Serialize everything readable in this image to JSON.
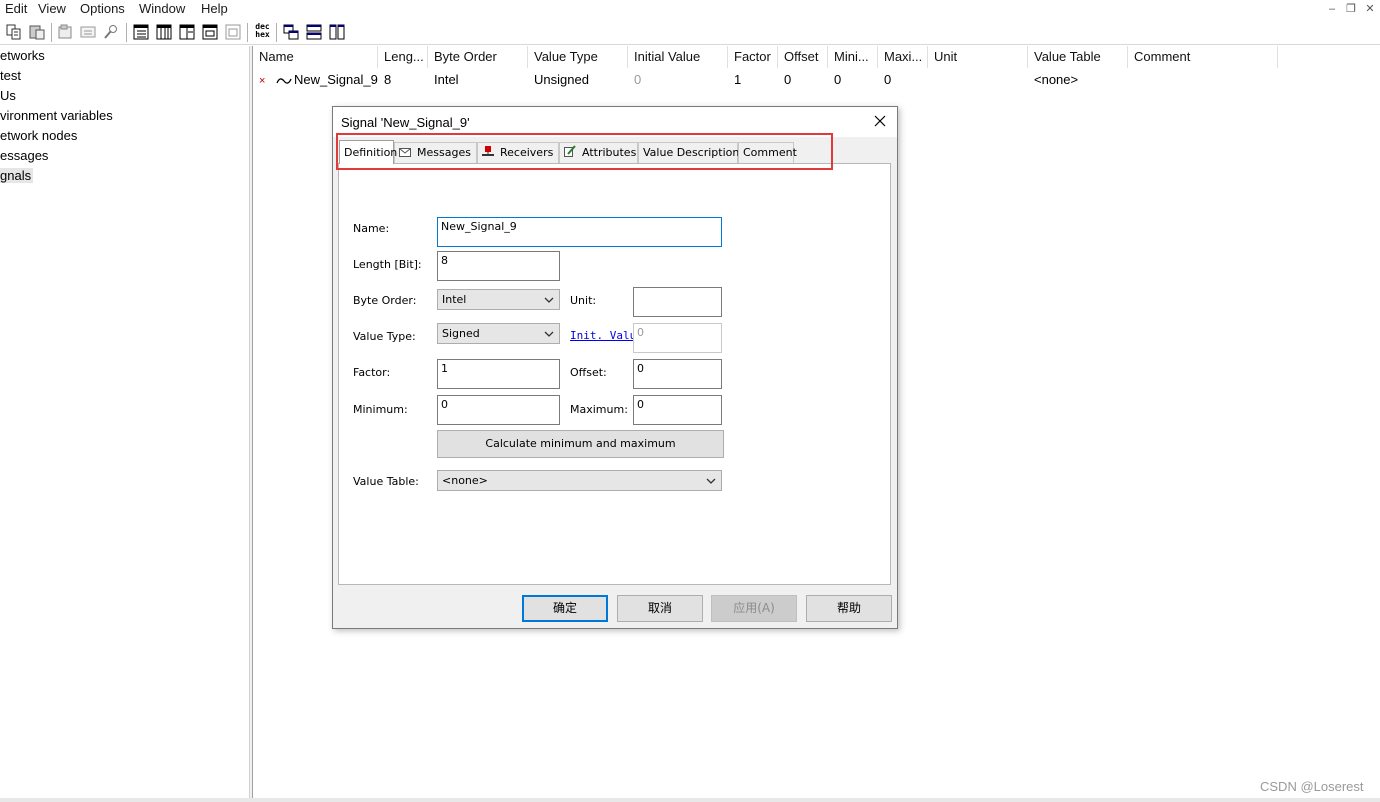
{
  "menubar": {
    "items": [
      "Edit",
      "View",
      "Options",
      "Window",
      "Help"
    ]
  },
  "toolbar": {
    "icons": [
      "copy-icon",
      "paste-icon",
      "properties-icon",
      "edit-list-icon",
      "tools-icon",
      "view-list-icon",
      "view-table-icon",
      "view-detail-icon",
      "view-window-icon",
      "view-print-icon",
      "dec-hex-icon",
      "cascade-icon",
      "tile-horizontal-icon",
      "tile-vertical-icon"
    ],
    "dec_hex_label_top": "dec",
    "dec_hex_label_bottom": "hex"
  },
  "tree": {
    "items": [
      "etworks",
      " test",
      "Us",
      "vironment variables",
      "etwork nodes",
      "essages",
      "gnals"
    ]
  },
  "list": {
    "columns": [
      "Name",
      "Leng...",
      "Byte Order",
      "Value Type",
      "Initial Value",
      "Factor",
      "Offset",
      "Mini...",
      "Maxi...",
      "Unit",
      "Value Table",
      "Comment"
    ],
    "row": {
      "marker": "×",
      "name": "New_Signal_9",
      "length": "8",
      "byte_order": "Intel",
      "value_type": "Unsigned",
      "initial_value": "0",
      "factor": "1",
      "offset": "0",
      "minimum": "0",
      "maximum": "0",
      "unit": "",
      "value_table": "<none>",
      "comment": ""
    }
  },
  "dialog": {
    "title": "Signal 'New_Signal_9'",
    "tabs": [
      "Definition",
      "Messages",
      "Receivers",
      "Attributes",
      "Value Descriptions",
      "Comment"
    ],
    "active_tab": "Definition",
    "labels": {
      "name": "Name:",
      "length": "Length [Bit]:",
      "byte_order": "Byte Order:",
      "unit": "Unit:",
      "value_type": "Value Type:",
      "init_value": "Init. Value",
      "factor": "Factor:",
      "offset": "Offset:",
      "minimum": "Minimum:",
      "maximum": "Maximum:",
      "value_table": "Value Table:"
    },
    "values": {
      "name": "New_Signal_9",
      "length": "8",
      "byte_order": "Intel",
      "unit": "",
      "value_type": "Signed",
      "init_value": "0",
      "factor": "1",
      "offset": "0",
      "minimum": "0",
      "maximum": "0",
      "value_table": "<none>"
    },
    "calc_button": "Calculate minimum and maximum",
    "buttons": {
      "ok": "确定",
      "cancel": "取消",
      "apply": "应用(A)",
      "help": "帮助"
    },
    "highlight_color": "#e03a3a"
  },
  "watermark": "CSDN @Loserest"
}
